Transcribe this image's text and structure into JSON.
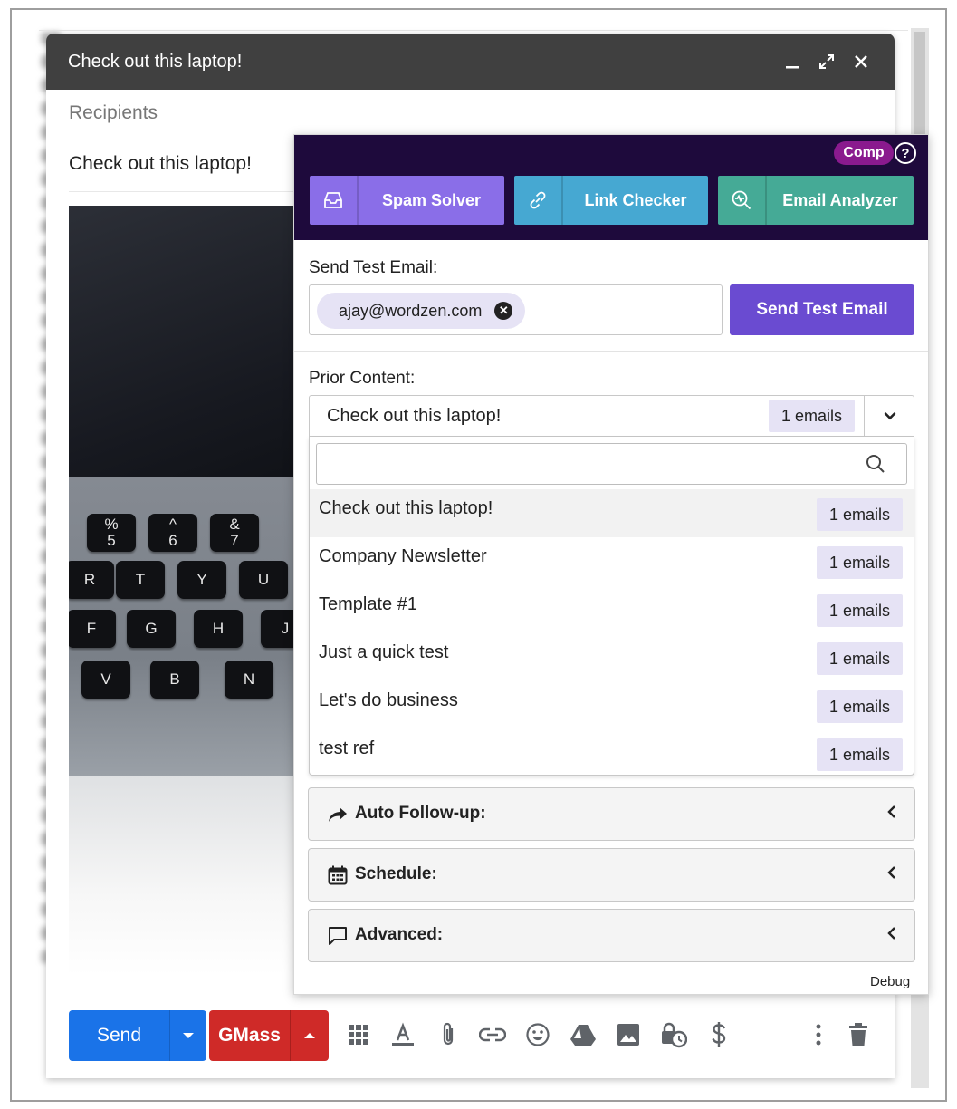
{
  "compose": {
    "title": "Check out this laptop!",
    "recipients_placeholder": "Recipients",
    "subject": "Check out this laptop!"
  },
  "photo_keys": [
    "%\n5",
    "^\n6",
    "&\n7",
    "R",
    "T",
    "Y",
    "U",
    "F",
    "G",
    "H",
    "J",
    "V",
    "B",
    "N"
  ],
  "footer": {
    "send_label": "Send",
    "gmass_label": "GMass"
  },
  "panel": {
    "badge": "Comp",
    "help": "?",
    "tools": [
      {
        "label": "Spam Solver",
        "color": "#8a6ee8"
      },
      {
        "label": "Link Checker",
        "color": "#46a8d2"
      },
      {
        "label": "Email Analyzer",
        "color": "#45aa96"
      }
    ],
    "send_test_label": "Send Test Email:",
    "test_email_chip": "ajay@wordzen.com",
    "send_test_button": "Send Test Email",
    "prior_content_label": "Prior Content:",
    "selected": {
      "name": "Check out this laptop!",
      "count": "1 emails"
    },
    "options": [
      {
        "name": "Check out this laptop!",
        "count": "1 emails"
      },
      {
        "name": "Company Newsletter",
        "count": "1 emails"
      },
      {
        "name": "Template #1",
        "count": "1 emails"
      },
      {
        "name": "Just a quick test",
        "count": "1 emails"
      },
      {
        "name": "Let's do business",
        "count": "1 emails"
      },
      {
        "name": "test ref",
        "count": "1 emails"
      }
    ],
    "sections": [
      {
        "label": "Auto Follow-up:",
        "icon": "share-arrow-icon"
      },
      {
        "label": "Schedule:",
        "icon": "calendar-icon"
      },
      {
        "label": "Advanced:",
        "icon": "speech-bubble-icon"
      }
    ],
    "debug": "Debug"
  },
  "colors": {
    "panel_header": "#1e0a3c",
    "send_blue": "#1a73e8",
    "gmass_red": "#cf2a28",
    "send_test_purple": "#6a4bd1",
    "comp_badge": "#8a1a8e"
  }
}
